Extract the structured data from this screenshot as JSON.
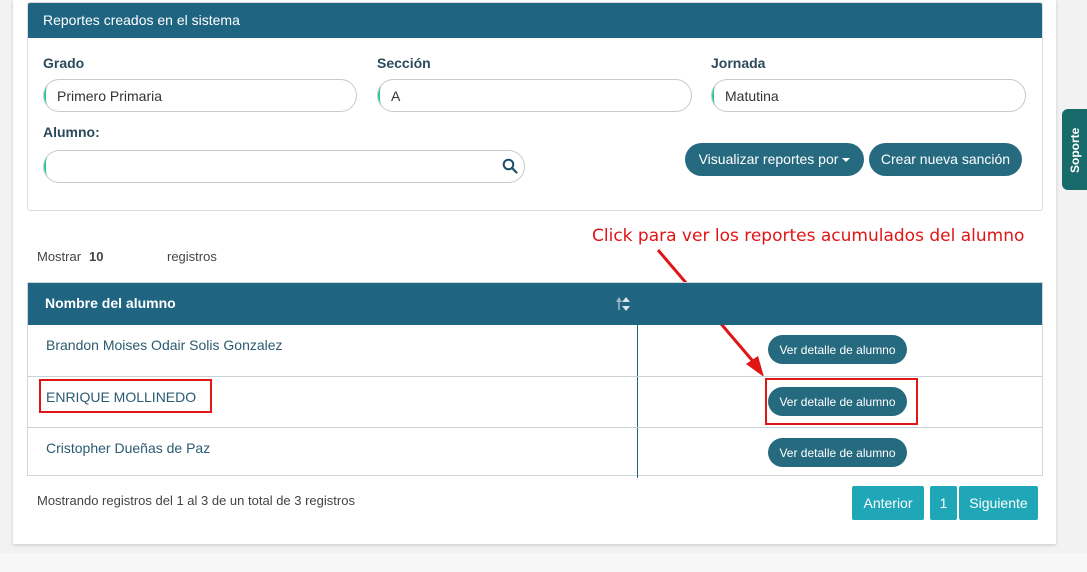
{
  "panel": {
    "title": "Reportes creados en el sistema"
  },
  "filters": {
    "grado": {
      "label": "Grado",
      "value": "Primero Primaria"
    },
    "seccion": {
      "label": "Sección",
      "value": "A"
    },
    "jornada": {
      "label": "Jornada",
      "value": "Matutina"
    },
    "alumno": {
      "label": "Alumno:",
      "value": ""
    }
  },
  "actions": {
    "visualizar": "Visualizar reportes por",
    "crear": "Crear nueva sanción"
  },
  "annotation": "Click para ver los reportes acumulados del alumno",
  "length": {
    "prefix": "Mostrar",
    "value": "10",
    "suffix": "registros"
  },
  "table": {
    "header_name": "Nombre del alumno",
    "rows": [
      {
        "name": "Brandon Moises Odair Solis Gonzalez",
        "action": "Ver detalle de alumno"
      },
      {
        "name": "ENRIQUE MOLLINEDO",
        "action": "Ver detalle de alumno"
      },
      {
        "name": "Cristopher Dueñas de Paz",
        "action": "Ver detalle de alumno"
      }
    ]
  },
  "footer": {
    "info": "Mostrando registros del 1 al 3 de un total de 3 registros"
  },
  "pagination": {
    "prev": "Anterior",
    "page": "1",
    "next": "Siguiente"
  },
  "side_tab": {
    "label": "Soporte"
  },
  "colors": {
    "header": "#1f6582",
    "button": "#266a80",
    "pager": "#1fa7b8",
    "annotation": "#e01515",
    "accent": "#23c89c"
  }
}
